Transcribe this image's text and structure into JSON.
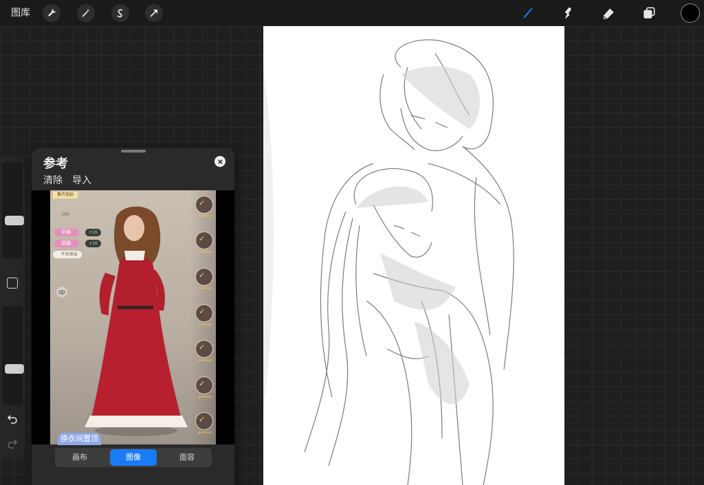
{
  "topbar": {
    "gallery_label": "图库",
    "left_tools": [
      "wrench-icon",
      "magic-wand-icon",
      "selection-s-icon",
      "transform-arrow-icon"
    ],
    "right_tools": [
      "brush-icon",
      "smudge-icon",
      "eraser-icon",
      "layers-icon"
    ],
    "current_color": "#000000",
    "accent": "#1a7cf5"
  },
  "reference_panel": {
    "title": "参考",
    "clear_label": "清除",
    "import_label": "导入",
    "tabs": [
      {
        "label": "画布",
        "active": false
      },
      {
        "label": "图像",
        "active": true
      },
      {
        "label": "面容",
        "active": false
      }
    ],
    "game_screenshot": {
      "badge": "集齐奖励",
      "count": "100",
      "attributes": [
        {
          "name": "华丽",
          "bonus": "+16"
        },
        {
          "name": "妩媚",
          "bonus": "+16"
        }
      ],
      "theme": "午后茶会",
      "pin_top_label": "换衣间置顶"
    }
  }
}
